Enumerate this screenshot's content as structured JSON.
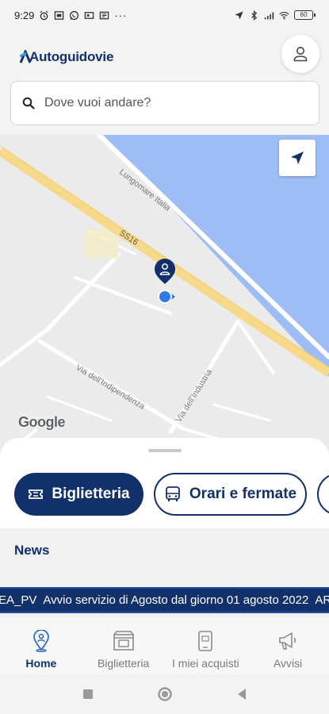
{
  "status_bar": {
    "time": "9:29",
    "battery": "60"
  },
  "header": {
    "logo_text": "Autoguidovie"
  },
  "search": {
    "placeholder": "Dove vuoi andare?"
  },
  "map": {
    "street_labels": [
      "Lungomare Italia",
      "SS16",
      "Via dell'Indipendenza",
      "Via dell'Industria"
    ],
    "attribution": "Google",
    "colors": {
      "land": "#ebebeb",
      "water": "#9ebcf6",
      "highway": "#f6d98a",
      "road": "#ffffff",
      "pin": "#12306a",
      "location": "#2f7de1"
    }
  },
  "sheet": {
    "tab_tickets": "Biglietteria",
    "tab_schedules": "Orari e fermate",
    "news_title": "News"
  },
  "ticker": {
    "prefix": "EA_PV",
    "message": "Avvio servizio di Agosto dal giorno 01 agosto 2022",
    "suffix": "AR"
  },
  "bottom_nav": {
    "items": [
      {
        "label": "Home",
        "icon": "location-pin-icon"
      },
      {
        "label": "Biglietteria",
        "icon": "ticket-office-icon"
      },
      {
        "label": "I miei acquisti",
        "icon": "phone-purchases-icon"
      },
      {
        "label": "Avvisi",
        "icon": "megaphone-icon"
      }
    ]
  },
  "colors": {
    "brand": "#12306a",
    "accent": "#2fa3e6",
    "inactive": "#7a7a7a"
  }
}
